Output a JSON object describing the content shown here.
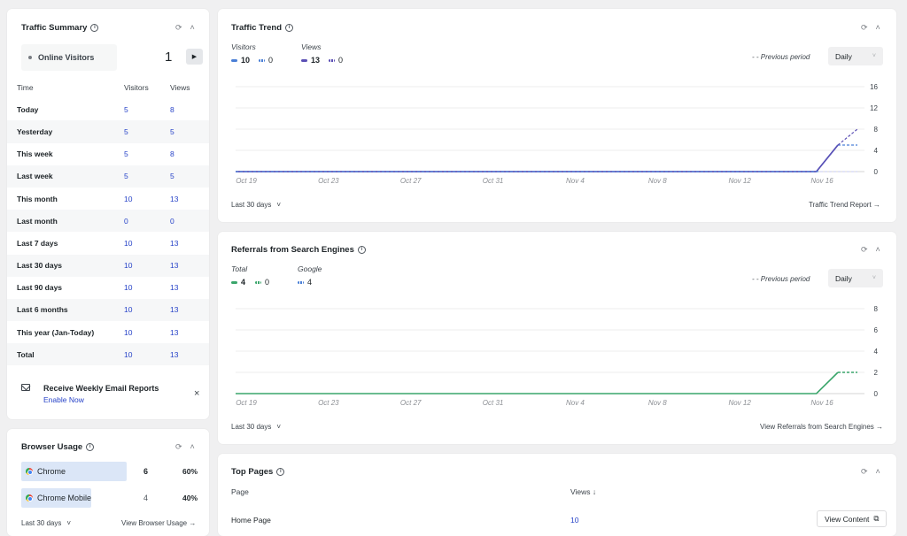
{
  "traffic_summary": {
    "title": "Traffic Summary",
    "online_label": "Online Visitors",
    "online_count": "1",
    "play_icon": "play-icon",
    "headers": {
      "time": "Time",
      "visitors": "Visitors",
      "views": "Views"
    },
    "rows": [
      {
        "label": "Today",
        "visitors": "5",
        "views": "8"
      },
      {
        "label": "Yesterday",
        "visitors": "5",
        "views": "5"
      },
      {
        "label": "This week",
        "visitors": "5",
        "views": "8"
      },
      {
        "label": "Last week",
        "visitors": "5",
        "views": "5"
      },
      {
        "label": "This month",
        "visitors": "10",
        "views": "13"
      },
      {
        "label": "Last month",
        "visitors": "0",
        "views": "0"
      },
      {
        "label": "Last 7 days",
        "visitors": "10",
        "views": "13"
      },
      {
        "label": "Last 30 days",
        "visitors": "10",
        "views": "13"
      },
      {
        "label": "Last 90 days",
        "visitors": "10",
        "views": "13"
      },
      {
        "label": "Last 6 months",
        "visitors": "10",
        "views": "13"
      },
      {
        "label": "This year (Jan-Today)",
        "visitors": "10",
        "views": "13"
      },
      {
        "label": "Total",
        "visitors": "10",
        "views": "13"
      }
    ],
    "email_title": "Receive Weekly Email Reports",
    "email_link": "Enable Now",
    "email_close": "×"
  },
  "browser_usage": {
    "title": "Browser Usage",
    "rows": [
      {
        "name": "Chrome",
        "count": "6",
        "percent": "60%",
        "share": 0.6
      },
      {
        "name": "Chrome Mobile",
        "count": "4",
        "percent": "40%",
        "share": 0.4
      }
    ],
    "footer_left": "Last 30 days",
    "footer_right": "View Browser Usage →"
  },
  "traffic_trend": {
    "title": "Traffic Trend",
    "group1_label": "Visitors",
    "group2_label": "Views",
    "legend": [
      {
        "value": "10",
        "color": "#4a7fd6",
        "dashed": false
      },
      {
        "value": "0",
        "color": "#4a7fd6",
        "dashed": true
      },
      {
        "value": "13",
        "color": "#5b4fb5",
        "dashed": false
      },
      {
        "value": "0",
        "color": "#5b4fb5",
        "dashed": true
      }
    ],
    "previous_period": "- -  Previous period",
    "select_value": "Daily",
    "footer_left": "Last 30 days",
    "footer_right": "Traffic Trend Report →",
    "chart_data": {
      "type": "line",
      "x": [
        "Oct 19",
        "Oct 23",
        "Oct 27",
        "Oct 31",
        "Nov 4",
        "Nov 8",
        "Nov 12",
        "Nov 16"
      ],
      "ylim": [
        0,
        16
      ],
      "yticks": [
        "16",
        "12",
        "8",
        "4",
        "0"
      ],
      "series": [
        {
          "name": "Visitors",
          "color": "#4a7fd6",
          "dashed": false,
          "values": [
            0,
            0,
            0,
            0,
            0,
            0,
            0,
            0,
            0,
            0,
            0,
            0,
            0,
            0,
            0,
            0,
            0,
            0,
            0,
            0,
            0,
            0,
            0,
            0,
            0,
            0,
            0,
            0,
            5
          ]
        },
        {
          "name": "Views",
          "color": "#5b4fb5",
          "dashed": false,
          "values": [
            0,
            0,
            0,
            0,
            0,
            0,
            0,
            0,
            0,
            0,
            0,
            0,
            0,
            0,
            0,
            0,
            0,
            0,
            0,
            0,
            0,
            0,
            0,
            0,
            0,
            0,
            0,
            0,
            5
          ]
        },
        {
          "name": "Visitors",
          "color": "#4a7fd6",
          "dashed": true,
          "values": [
            0,
            0,
            0,
            0,
            0,
            0,
            0,
            0,
            0,
            0,
            0,
            0,
            0,
            0,
            0,
            0,
            0,
            0,
            0,
            0,
            0,
            0,
            0,
            0,
            0,
            0,
            0,
            0,
            0
          ]
        },
        {
          "name": "Views",
          "color": "#5b4fb5",
          "dashed": true,
          "tail": [
            5,
            8
          ]
        }
      ]
    }
  },
  "search_engines": {
    "title": "Referrals from Search Engines",
    "group1_label": "Total",
    "group2_label": "Google",
    "legend": [
      {
        "value": "4",
        "color": "#3aa56b",
        "dashed": false
      },
      {
        "value": "0",
        "color": "#3aa56b",
        "dashed": true
      },
      {
        "value": "4",
        "color": "#4a7fd6",
        "dashed": true
      }
    ],
    "previous_period": "- -  Previous period",
    "select_value": "Daily",
    "footer_left": "Last 30 days",
    "footer_right": "View Referrals from Search Engines →",
    "chart_data": {
      "type": "line",
      "x": [
        "Oct 19",
        "Oct 23",
        "Oct 27",
        "Oct 31",
        "Nov 4",
        "Nov 8",
        "Nov 12",
        "Nov 16"
      ],
      "ylim": [
        0,
        8
      ],
      "yticks": [
        "8",
        "6",
        "4",
        "2",
        "0"
      ],
      "series": [
        {
          "name": "Total",
          "color": "#3aa56b",
          "dashed": false,
          "values": [
            0,
            0,
            0,
            0,
            0,
            0,
            0,
            0,
            0,
            0,
            0,
            0,
            0,
            0,
            0,
            0,
            0,
            0,
            0,
            0,
            0,
            0,
            0,
            0,
            0,
            0,
            0,
            0,
            2
          ]
        }
      ]
    }
  },
  "top_pages": {
    "title": "Top Pages",
    "headers": {
      "page": "Page",
      "views": "Views ↓"
    },
    "rows": [
      {
        "page": "Home Page",
        "views": "10",
        "action": "View Content"
      }
    ]
  },
  "icons": {
    "refresh": "refresh-icon",
    "collapse": "chevron-up-icon",
    "info": "info-icon",
    "mail": "mail-icon",
    "external": "external-link-icon"
  }
}
